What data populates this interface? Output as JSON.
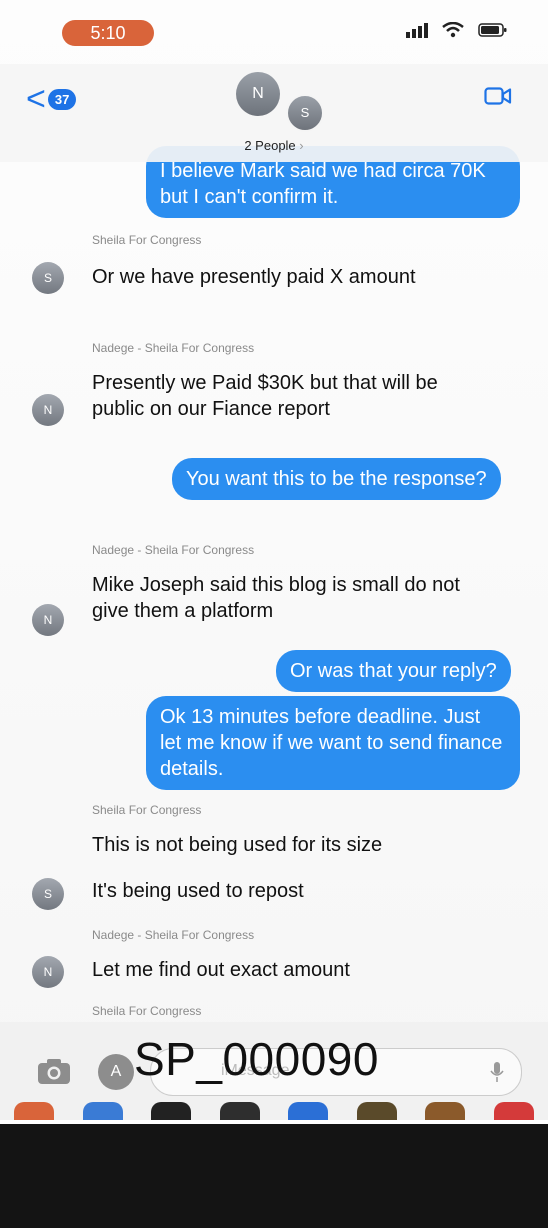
{
  "status": {
    "time": "5:10"
  },
  "header": {
    "back_count": "37",
    "avatar_primary": "N",
    "avatar_secondary": "S",
    "group_label": "2 People",
    "group_chevron": "›"
  },
  "messages": {
    "out_top": "I believe Mark said we had circa 70K but I can't confirm it.",
    "sender1": "Sheila For Congress",
    "m1": "Or we have presently paid X amount",
    "sender2": "Nadege - Sheila For Congress",
    "m2": "Presently we Paid $30K but that will be public on our Fiance report",
    "out1": "You want this to be the response?",
    "sender3": "Nadege - Sheila For Congress",
    "m3": "Mike Joseph said this blog is small do not give them a platform",
    "out2": "Or was that your reply?",
    "out3": "Ok 13 minutes before deadline. Just let me know if we want to send finance details.",
    "sender4": "Sheila For Congress",
    "m4": "This is not being used for its size",
    "m5": "It's being used to repost",
    "sender5": "Nadege - Sheila For Congress",
    "m6": "Let me find out exact amount",
    "sender6": "Sheila For Congress",
    "av_s": "S",
    "av_n": "N"
  },
  "input": {
    "placeholder": "iMessage",
    "stamp": "SP_000090"
  },
  "icons": [
    "back-chevron-icon",
    "video-camera-icon",
    "camera-icon",
    "app-store-icon",
    "microphone-icon",
    "signal-icon",
    "wifi-icon",
    "battery-icon"
  ],
  "colors": {
    "accent": "#2b8ef0",
    "time_pill": "#d9643a"
  }
}
